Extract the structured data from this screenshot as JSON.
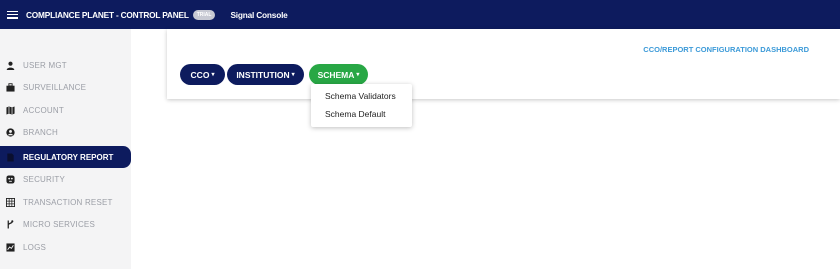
{
  "topbar": {
    "menu_icon": "hamburger-icon",
    "app_title": "COMPLIANCE PLANET - CONTROL PANEL",
    "badge": "TRIAL",
    "console_name": "Signal Console"
  },
  "sidebar": {
    "items": [
      {
        "label": "USER MGT",
        "icon": "user-icon"
      },
      {
        "label": "SURVEILLANCE",
        "icon": "briefcase-icon"
      },
      {
        "label": "ACCOUNT",
        "icon": "map-icon"
      },
      {
        "label": "BRANCH",
        "icon": "account-circle-icon"
      },
      {
        "label": "REGULATORY REPORT",
        "icon": "document-icon",
        "active": true
      },
      {
        "label": "SECURITY",
        "icon": "shield-icon"
      },
      {
        "label": "TRANSACTION RESET",
        "icon": "table-icon"
      },
      {
        "label": "MICRO SERVICES",
        "icon": "git-branch-icon"
      },
      {
        "label": "LOGS",
        "icon": "chart-box-icon"
      }
    ]
  },
  "main": {
    "dashboard_title": "CCO/REPORT CONFIGURATION DASHBOARD",
    "buttons": [
      {
        "label": "CCO",
        "caret": "▾"
      },
      {
        "label": "INSTITUTION",
        "caret": "▾"
      },
      {
        "label": "SCHEMA",
        "caret": "▾",
        "open": true
      }
    ],
    "dropdown": [
      "Schema Validators",
      "Schema Default"
    ]
  },
  "colors": {
    "navy": "#0d1b5e",
    "green": "#28a745",
    "link_blue": "#3c9ad8",
    "sidebar_bg": "#f4f4f5",
    "sidebar_text": "#9b9ea6"
  }
}
